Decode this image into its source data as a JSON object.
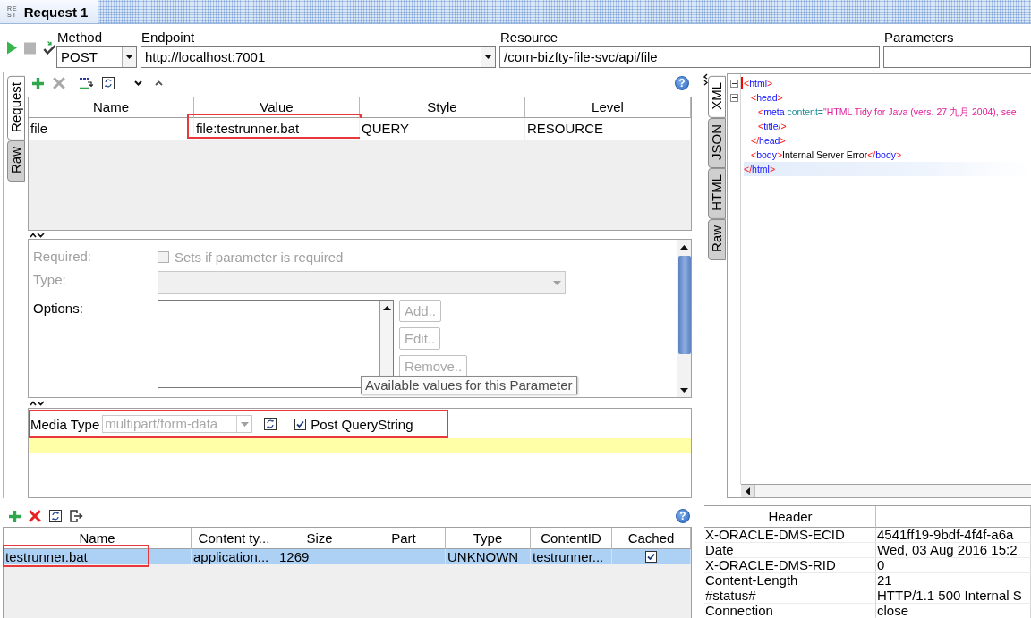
{
  "tab": {
    "icon_lines": [
      "RE",
      "ST"
    ],
    "title": "Request 1",
    "selected": true
  },
  "toolbar": {
    "actions": [
      {
        "kind": "run",
        "disabled": false
      },
      {
        "kind": "stop",
        "disabled": true
      },
      {
        "kind": "validate",
        "disabled": false
      }
    ],
    "method": {
      "label": "Method",
      "value": "POST"
    },
    "endpoint": {
      "label": "Endpoint",
      "value": "http://localhost:7001"
    },
    "resource": {
      "label": "Resource",
      "value": "/com-bizfty-file-svc/api/file"
    },
    "parameters": {
      "label": "Parameters"
    }
  },
  "request_tabs": [
    {
      "label": "Request",
      "selected": true
    },
    {
      "label": "Raw",
      "selected": false
    }
  ],
  "params": {
    "actions": [
      {
        "kind": "add",
        "disabled": false
      },
      {
        "kind": "remove",
        "disabled": true
      },
      {
        "kind": "url",
        "disabled": false
      },
      {
        "kind": "refresh",
        "disabled": false
      },
      {
        "kind": "move_down",
        "disabled": false
      },
      {
        "kind": "move_up",
        "disabled": false
      }
    ],
    "help": "?",
    "columns": [
      "Name",
      "Value",
      "Style",
      "Level"
    ],
    "rows": [
      {
        "cells": [
          {
            "text": "file",
            "highlighted": false
          },
          {
            "text": "file:testrunner.bat",
            "highlighted": true
          },
          {
            "text": "QUERY",
            "highlighted": false
          },
          {
            "text": "RESOURCE",
            "highlighted": false
          }
        ]
      }
    ]
  },
  "details": {
    "required": {
      "label": "Required:",
      "checkbox_label": "Sets if parameter is required",
      "checked": false,
      "disabled": true
    },
    "type": {
      "label": "Type:",
      "disabled": true
    },
    "options": {
      "label": "Options:",
      "buttons": [
        {
          "label": "Add..",
          "disabled": true
        },
        {
          "label": "Edit..",
          "disabled": true
        },
        {
          "label": "Remove..",
          "disabled": true
        }
      ]
    },
    "tooltip": "Available values for this Parameter"
  },
  "media": {
    "label": "Media Type",
    "value": "multipart/form-data",
    "disabled": true,
    "highlighted": true,
    "post_querystring": {
      "label": "Post QueryString",
      "checked": true
    }
  },
  "attachments": {
    "actions": [
      {
        "kind": "add",
        "disabled": false
      },
      {
        "kind": "remove",
        "disabled": false
      },
      {
        "kind": "refresh",
        "disabled": false
      },
      {
        "kind": "export",
        "disabled": false
      }
    ],
    "help": "?",
    "columns": [
      "Name",
      "Content ty...",
      "Size",
      "Part",
      "Type",
      "ContentID",
      "Cached"
    ],
    "rows": [
      {
        "selected": true,
        "cached": true,
        "cells": [
          {
            "text": "testrunner.bat",
            "highlighted": true
          },
          {
            "text": "application...",
            "highlighted": false
          },
          {
            "text": "1269",
            "highlighted": false
          },
          {
            "highlighted": false
          },
          {
            "text": "UNKNOWN",
            "highlighted": false
          },
          {
            "text": "testrunner...",
            "highlighted": false
          }
        ]
      }
    ]
  },
  "response_tabs": [
    {
      "label": "XML",
      "selected": true
    },
    {
      "label": "JSON",
      "selected": false
    },
    {
      "label": "HTML",
      "selected": false
    },
    {
      "label": "Raw",
      "selected": false
    }
  ],
  "xml": {
    "lines": [
      {
        "tokens": [
          {
            "kind": "bracket",
            "text": "<"
          },
          {
            "kind": "tag",
            "text": "html"
          },
          {
            "kind": "bracket",
            "text": ">"
          }
        ],
        "expanded": true,
        "selected": false,
        "children": [
          {
            "tokens": [
              {
                "kind": "bracket",
                "text": "<"
              },
              {
                "kind": "tag",
                "text": "head"
              },
              {
                "kind": "bracket",
                "text": ">"
              }
            ],
            "expanded": true,
            "selected": false,
            "children": [
              {
                "tokens": [
                  {
                    "kind": "bracket",
                    "text": "<"
                  },
                  {
                    "kind": "tag",
                    "text": "meta"
                  },
                  {
                    "kind": "attribute",
                    "text": " content"
                  },
                  {
                    "kind": "equals",
                    "text": "="
                  },
                  {
                    "kind": "value",
                    "text": "\"HTML Tidy for Java (vers. 27 九月 2004), see"
                  }
                ],
                "selected": false
              },
              {
                "tokens": [
                  {
                    "kind": "bracket",
                    "text": "<"
                  },
                  {
                    "kind": "tag",
                    "text": "title"
                  },
                  {
                    "kind": "bracket",
                    "text": "/>"
                  }
                ],
                "selected": false
              }
            ]
          },
          {
            "tokens": [
              {
                "kind": "bracket",
                "text": "</"
              },
              {
                "kind": "tag",
                "text": "head"
              },
              {
                "kind": "bracket",
                "text": ">"
              }
            ],
            "selected": false
          },
          {
            "tokens": [
              {
                "kind": "bracket",
                "text": "<"
              },
              {
                "kind": "tag",
                "text": "body"
              },
              {
                "kind": "bracket",
                "text": ">"
              },
              {
                "kind": "text",
                "text": "Internal Server Error"
              },
              {
                "kind": "bracket",
                "text": "</"
              },
              {
                "kind": "tag",
                "text": "body"
              },
              {
                "kind": "bracket",
                "text": ">"
              }
            ],
            "selected": false
          }
        ]
      },
      {
        "tokens": [
          {
            "kind": "bracket",
            "text": "</"
          },
          {
            "kind": "tag",
            "text": "html"
          },
          {
            "kind": "bracket",
            "text": ">"
          }
        ],
        "selected": true
      }
    ]
  },
  "headers": {
    "columns": [
      "Header"
    ],
    "rows": [
      {
        "name": "X-ORACLE-DMS-ECID",
        "value": "4541ff19-9bdf-4f4f-a6a"
      },
      {
        "name": "Date",
        "value": "Wed, 03 Aug 2016 15:2"
      },
      {
        "name": "X-ORACLE-DMS-RID",
        "value": "0"
      },
      {
        "name": "Content-Length",
        "value": "21"
      },
      {
        "name": "#status#",
        "value": "HTTP/1.1 500 Internal S"
      },
      {
        "name": "Connection",
        "value": "close"
      }
    ]
  }
}
